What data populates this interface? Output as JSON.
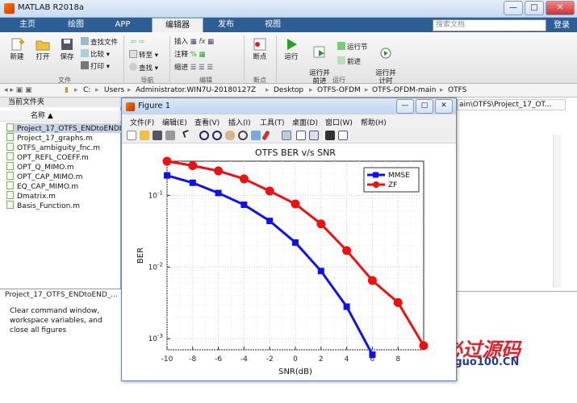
{
  "window": {
    "title": "MATLAB R2018a",
    "min": "—",
    "max": "□",
    "close": "✕"
  },
  "tabs": [
    {
      "label": "主页"
    },
    {
      "label": "绘图"
    },
    {
      "label": "APP"
    },
    {
      "label": "编辑器",
      "active": true
    },
    {
      "label": "发布"
    },
    {
      "label": "视图"
    }
  ],
  "search": {
    "placeholder": "搜索文档"
  },
  "login": "登录",
  "ribbon": {
    "file": {
      "new": "新建",
      "open": "打开",
      "save": "保存",
      "find_files": "查找文件",
      "compare": "比较",
      "print": "打印",
      "group": "文件"
    },
    "nav": {
      "goto": "转至",
      "find": "查找",
      "group": "导航"
    },
    "edit": {
      "insert": "插入",
      "comment": "注释",
      "indent": "缩进",
      "group": "编辑"
    },
    "breakpoints": {
      "label": "断点",
      "group": "断点"
    },
    "run": {
      "run": "运行",
      "run_advance": "运行并\n前进",
      "run_section": "运行节",
      "advance": "前进",
      "run_time": "运行并\n计时",
      "group": "运行"
    }
  },
  "address": {
    "crumbs": [
      "C:",
      "Users",
      "Administrator.WIN7U-20180127Z",
      "Desktop",
      "OTFS-OFDM",
      "OTFS-OFDM-main",
      "OTFS"
    ]
  },
  "current_folder": {
    "header": "当前文件夹",
    "column": "名称 ▲",
    "files": [
      "Project_17_OTFS_ENDtoENDI",
      "Project_17_graphs.m",
      "OTFS_ambiguity_fnc.m",
      "OPT_REFL_COEFF.m",
      "OPT_Q_MIMO.m",
      "OPT_CAP_MIMO.m",
      "EQ_CAP_MIMO.m",
      "Dmatrix.m",
      "Basis_Function.m"
    ]
  },
  "details": {
    "title": "Project_17_OTFS_ENDtoEND_...",
    "text": "Clear command window, workspace variables, and close all figures"
  },
  "editor_path": "ain\\OTFS\\Project_17_OT...",
  "figure": {
    "title": "Figure 1",
    "menus": [
      "文件(F)",
      "编辑(E)",
      "查看(V)",
      "插入(I)",
      "工具(T)",
      "桌面(D)",
      "窗口(W)",
      "帮助(H)"
    ]
  },
  "colors": {
    "zf": "#ee1111",
    "mmse": "#1010ee",
    "tabbar": "#2d5f95"
  },
  "chart_data": {
    "type": "line",
    "title": "OTFS BER v/s SNR",
    "xlabel": "SNR(dB)",
    "ylabel": "BER",
    "xlim": [
      -10,
      10
    ],
    "ylim": [
      0.0007,
      0.3
    ],
    "yscale": "log",
    "grid": true,
    "legend_position": "top-right",
    "xticks": [
      -10,
      -8,
      -6,
      -4,
      -2,
      0,
      2,
      4,
      6,
      8
    ],
    "yticks": [
      {
        "v": 0.1,
        "label": "10^-1"
      },
      {
        "v": 0.01,
        "label": "10^-2"
      },
      {
        "v": 0.001,
        "label": "10^-3"
      }
    ],
    "x": [
      -10,
      -8,
      -6,
      -4,
      -2,
      0,
      2,
      4,
      6,
      8,
      10
    ],
    "series": [
      {
        "name": "MMSE",
        "color": "#1010ee",
        "marker": "square",
        "x": [
          -10,
          -8,
          -6,
          -4,
          -2,
          0,
          2,
          4,
          6
        ],
        "values": [
          0.19,
          0.15,
          0.108,
          0.074,
          0.044,
          0.022,
          0.0088,
          0.0028,
          0.0006
        ]
      },
      {
        "name": "ZF",
        "color": "#ee1111",
        "marker": "circle",
        "x": [
          -10,
          -8,
          -6,
          -4,
          -2,
          0,
          2,
          4,
          6,
          8,
          10
        ],
        "values": [
          0.3,
          0.26,
          0.22,
          0.17,
          0.115,
          0.076,
          0.04,
          0.017,
          0.0065,
          0.0032,
          0.0008
        ]
      }
    ]
  },
  "watermark": {
    "line1": "必过源码",
    "line2": "Biguo100.CN"
  }
}
